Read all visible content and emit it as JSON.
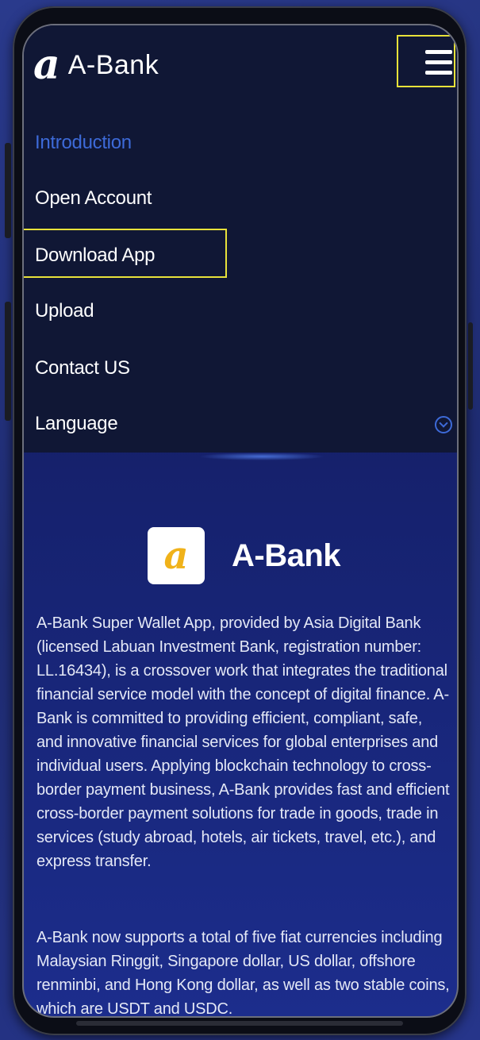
{
  "header": {
    "logo_mark": "a",
    "logo_text": "A-Bank",
    "menu_icon": "hamburger-menu-icon"
  },
  "menu": {
    "items": [
      {
        "label": "Introduction",
        "active": true
      },
      {
        "label": "Open Account",
        "active": false
      },
      {
        "label": "Download App",
        "active": false
      },
      {
        "label": "Upload",
        "active": false
      },
      {
        "label": "Contact US",
        "active": false
      },
      {
        "label": "Language",
        "active": false
      }
    ],
    "language_toggle_icon": "chevron-down-circle-icon"
  },
  "brand": {
    "icon_letter": "a",
    "name": "A-Bank"
  },
  "content": {
    "paragraph1": "A-Bank Super Wallet App, provided by Asia Digital Bank (licensed Labuan Investment Bank, registration number: LL.16434), is a crossover work that integrates the traditional financial service model with the concept of digital finance. A-Bank is committed to providing efficient, compliant, safe, and innovative financial services for global enterprises and individual users. Applying blockchain technology to cross-border payment business, A-Bank provides fast and efficient cross-border payment solutions for trade in goods, trade in services (study abroad, hotels, air tickets, travel, etc.), and express transfer.",
    "paragraph2": "A-Bank now supports a total of five fiat currencies including Malaysian Ringgit, Singapore dollar, US dollar, offshore renminbi, and Hong Kong dollar, as well as two stable coins, which are USDT and USDC."
  },
  "colors": {
    "menu_bg": "#101735",
    "active_link": "#3d6ad8",
    "highlight_box": "#e8e23a",
    "page_gradient_end": "#1c2d8c"
  }
}
